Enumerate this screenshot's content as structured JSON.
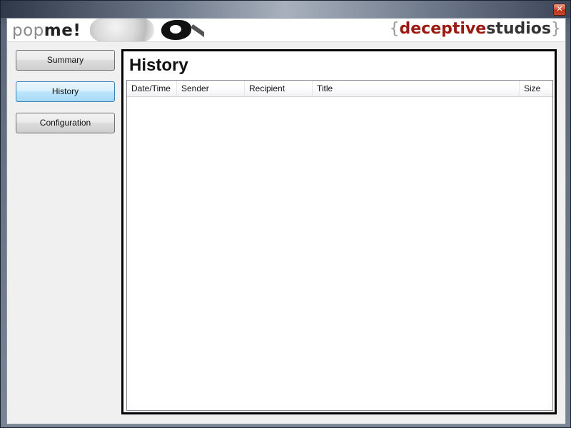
{
  "window": {
    "close_glyph": "✕"
  },
  "banner": {
    "logo_left_pop": "pop",
    "logo_left_me": "me!",
    "logo_right_open": "{",
    "logo_right_deceptive": "deceptive",
    "logo_right_studios": "studios",
    "logo_right_close": "}"
  },
  "nav": {
    "items": [
      {
        "label": "Summary",
        "active": false
      },
      {
        "label": "History",
        "active": true
      },
      {
        "label": "Configuration",
        "active": false
      }
    ]
  },
  "main": {
    "title": "History",
    "columns": [
      "Date/Time",
      "Sender",
      "Recipient",
      "Title",
      "Size"
    ],
    "rows": []
  },
  "colors": {
    "accent_brand": "#9b1b12",
    "active_button": "#bee6fd",
    "panel_border": "#000000"
  },
  "icons": {
    "close": "close-icon"
  }
}
